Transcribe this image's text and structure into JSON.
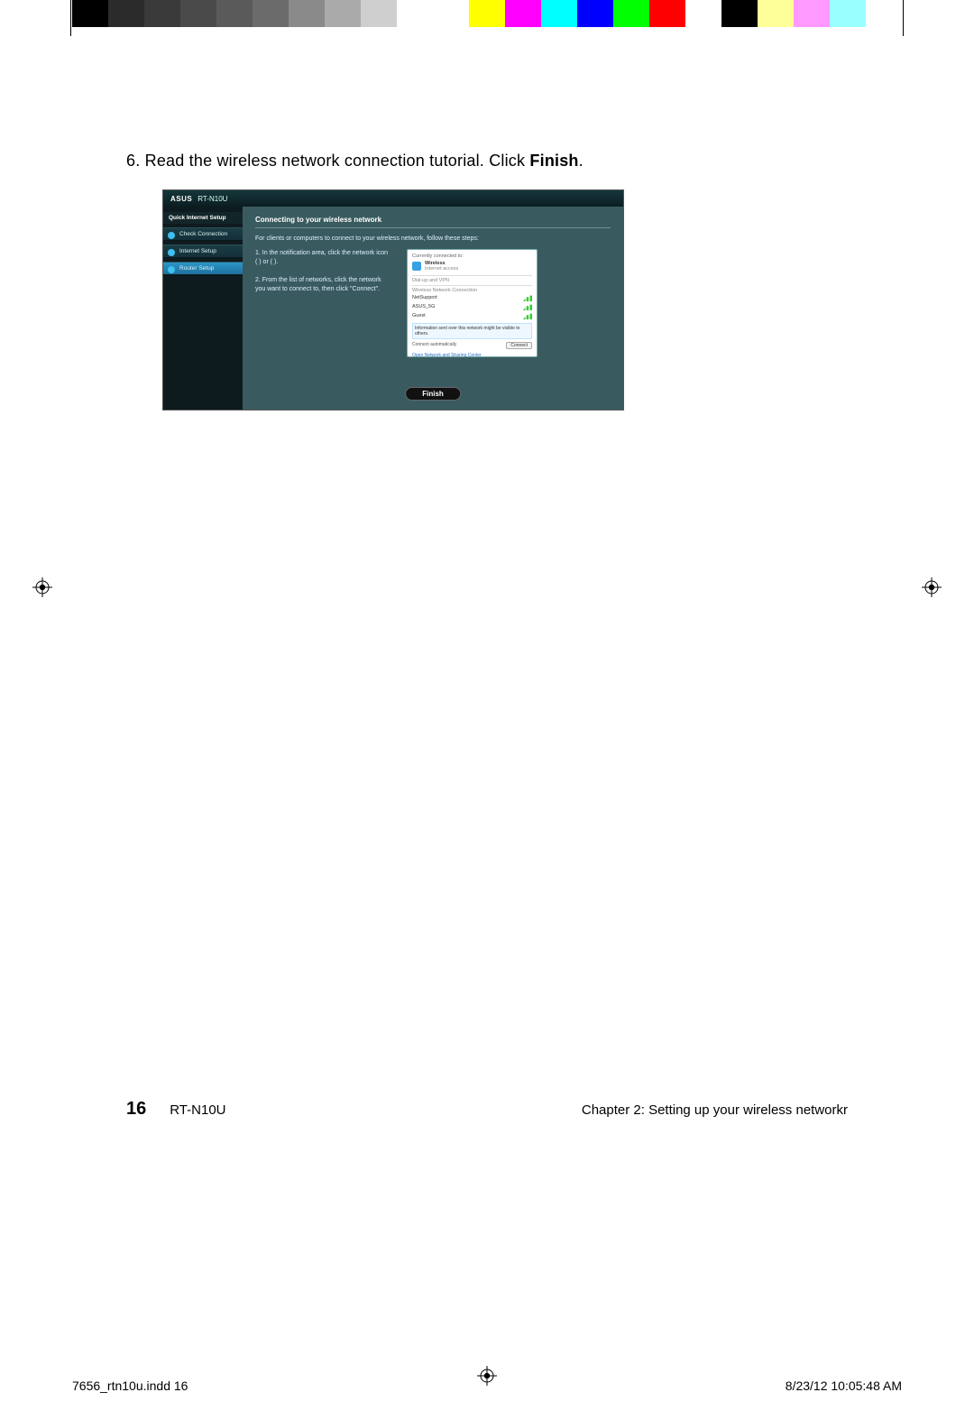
{
  "colorbar": [
    "#000000",
    "#2b2b2b",
    "#3a3a3a",
    "#4a4a4a",
    "#5a5a5a",
    "#6b6b6b",
    "#8a8a8a",
    "#aaaaaa",
    "#cfcfcf",
    "#ffffff",
    "#ffffff",
    "#ffff00",
    "#ff00ff",
    "#00ffff",
    "#0000ff",
    "#00ff00",
    "#ff0000",
    "#ffffff",
    "#000000",
    "#ffff99",
    "#ff99ff",
    "#99ffff",
    "#ffffff"
  ],
  "instruction": {
    "number": "6.",
    "text_before": " Read the wireless network connection tutorial. Click ",
    "bold_word": "Finish",
    "text_after": "."
  },
  "router_ui": {
    "brand": "ASUS",
    "model": "RT-N10U",
    "sidebar_header": "Quick Internet Setup",
    "sidebar": [
      {
        "label": "Check Connection",
        "active": false
      },
      {
        "label": "Internet Setup",
        "active": false
      },
      {
        "label": "Router Setup",
        "active": true
      }
    ],
    "panel_title": "Connecting to your wireless network",
    "panel_intro": "For clients or computers to connect to your wireless network, follow these steps:",
    "step1": "1. In the notification area, click the network icon (   ) or (   ).",
    "step2": "2. From the list of networks, click the network you want to connect to, then click \"Connect\".",
    "popup": {
      "header": "Currently connected to:",
      "wireless_label": "Wireless",
      "wireless_sub": "Internet access",
      "section": "Dial-up and VPN",
      "section2": "Wireless Network Connection",
      "networks": [
        "NetSupport",
        "ASUS_5G",
        "Guest"
      ],
      "highlight": "Information sent over this network might be visible to others.",
      "auto": "Connect automatically",
      "connect": "Connect",
      "footer_link": "Open Network and Sharing Center"
    },
    "finish_button": "Finish"
  },
  "footer": {
    "page_number": "16",
    "model": "RT-N10U",
    "chapter": "Chapter 2: Setting up your wireless networkr"
  },
  "slug": {
    "file": "7656_rtn10u.indd   16",
    "timestamp": "8/23/12   10:05:48 AM"
  }
}
